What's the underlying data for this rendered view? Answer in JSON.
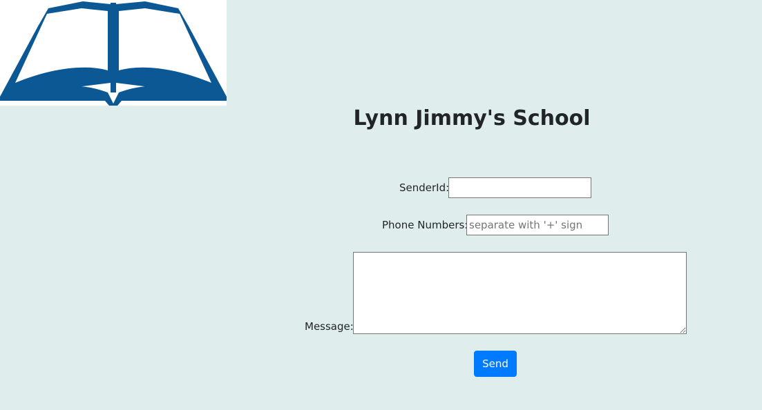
{
  "logo": {
    "icon": "open-book-icon",
    "color": "#0b5895"
  },
  "header": {
    "title": "Lynn Jimmy's School"
  },
  "form": {
    "sender_label": "SenderId:",
    "sender_value": "",
    "phone_label": "Phone Numbers:",
    "phone_placeholder": "separate with '+' sign",
    "message_label": "Message:",
    "message_value": "",
    "send_label": "Send"
  },
  "colors": {
    "background": "#e0eded",
    "button": "#007bff",
    "button_text": "#ffffff"
  }
}
